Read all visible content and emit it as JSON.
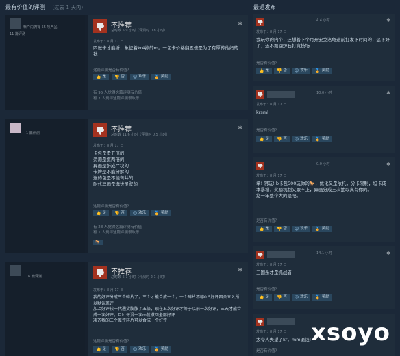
{
  "left": {
    "section_title": "最有价值的评测",
    "section_sub": "（过去 1 天内）",
    "reviews": [
      {
        "author_meta": "帐户内拥有 55 项产品",
        "author_count": "11 篇评测",
        "title": "不推荐",
        "hours": "总时数 5.9 小时（评测时 0.8 小时）",
        "posted": "发布于：8 月 17 日",
        "text": "四张卡才能拆，象征着kr4掉的m。一包卡价格翻五倍是为了有厚葬他妈的钱",
        "question": "这篇评测是否有价值？",
        "buttons": [
          "是",
          "否",
          "欢乐",
          "奖励"
        ],
        "stats": [
          "有 95 人觉得这篇评测有价值",
          "有 7 人觉得这篇评测很欢乐"
        ],
        "award": ""
      },
      {
        "author_meta": "",
        "author_count": "1 篇评测",
        "title": "不推荐",
        "hours": "总时数 11.6 小时（评测时 0.5 小时）",
        "posted": "发布于：8 月 17 日",
        "text": "卡包是贵五倍的\n资源是抠两倍的\n异画是拆成尸块的\n卡牌是不能分解的\n送的包是不能菁井的\n耐代异画是选进灵壁的",
        "question": "这篇评测是否有价值？",
        "buttons": [
          "是",
          "否",
          "欢乐",
          "奖励"
        ],
        "stats": [
          "有 28 人觉得这篇评测有价值",
          "有 1 人觉得这篇评测很欢乐"
        ],
        "award": "🐎"
      },
      {
        "author_meta": "",
        "author_count": "16 篇评测",
        "title": "不推荐",
        "hours": "总时数 5.1 小时（评测时 2.1 小时）",
        "posted": "发布于：8 月 17 日",
        "text": "我的好评分成三个碎片了，三个才能合成一个，一个碎片不够0.5好评四舍五入所以默认差评\n加上好评较一代通货膨胀了五倍，现在五次好评才等于以前一次好评，三天才能合成一次好评，且kr每没一次m就撤回全部好评\n凑齐我的三个差评碎片可以合成一个好评",
        "question": "这篇评测是否有价值？",
        "buttons": [
          "是",
          "否",
          "欢乐",
          "奖励"
        ],
        "stats": [],
        "award": ""
      }
    ]
  },
  "right": {
    "section_title": "最近发布",
    "reviews": [
      {
        "time": "4.4 小时",
        "posted": "发布于：8 月 17 日",
        "text": "我玩你的内个，还想着下个月开安戈洛龟途前打发下时间的，这下好了，还不如回炉石打竞技场",
        "question": "是否有价值？",
        "buttons": [
          "是",
          "否",
          "欢乐",
          "奖励"
        ]
      },
      {
        "time": "10.0 小时",
        "posted": "发布于：8 月 17 日",
        "text": "krsml",
        "question": "是否有价值？",
        "buttons": [
          "是",
          "否",
          "欢乐",
          "奖励"
        ]
      },
      {
        "time": "0.0 小时",
        "posted": "发布于：8 月 17 日",
        "text": "拿! 阴玩! b卡包500玩你的🐎，优化又是依托，分卡限制，坦卡成本暴增，奖励机制又跟不上，异画分成三次抽取真有你的。\n您一年整个大的是吧。",
        "question": "是否有价值？",
        "buttons": [
          "是",
          "否",
          "欢乐",
          "奖励"
        ]
      },
      {
        "time": "14.1 小时",
        "posted": "发布于：8 月 17 日",
        "text": "三国杀才是抓战者",
        "question": "是否有价值？",
        "buttons": [
          "是",
          "否",
          "欢乐",
          "奖励"
        ]
      },
      {
        "time": "",
        "posted": "发布于：8 月 17 日",
        "text": "太令人失望了kr，mm退钱!",
        "question": "是否有价值？",
        "buttons": []
      }
    ]
  },
  "watermark": "xsoyo",
  "colors": {
    "bg": "#1b2838",
    "thumb_down": "#a3321f",
    "button": "#2a475e"
  }
}
